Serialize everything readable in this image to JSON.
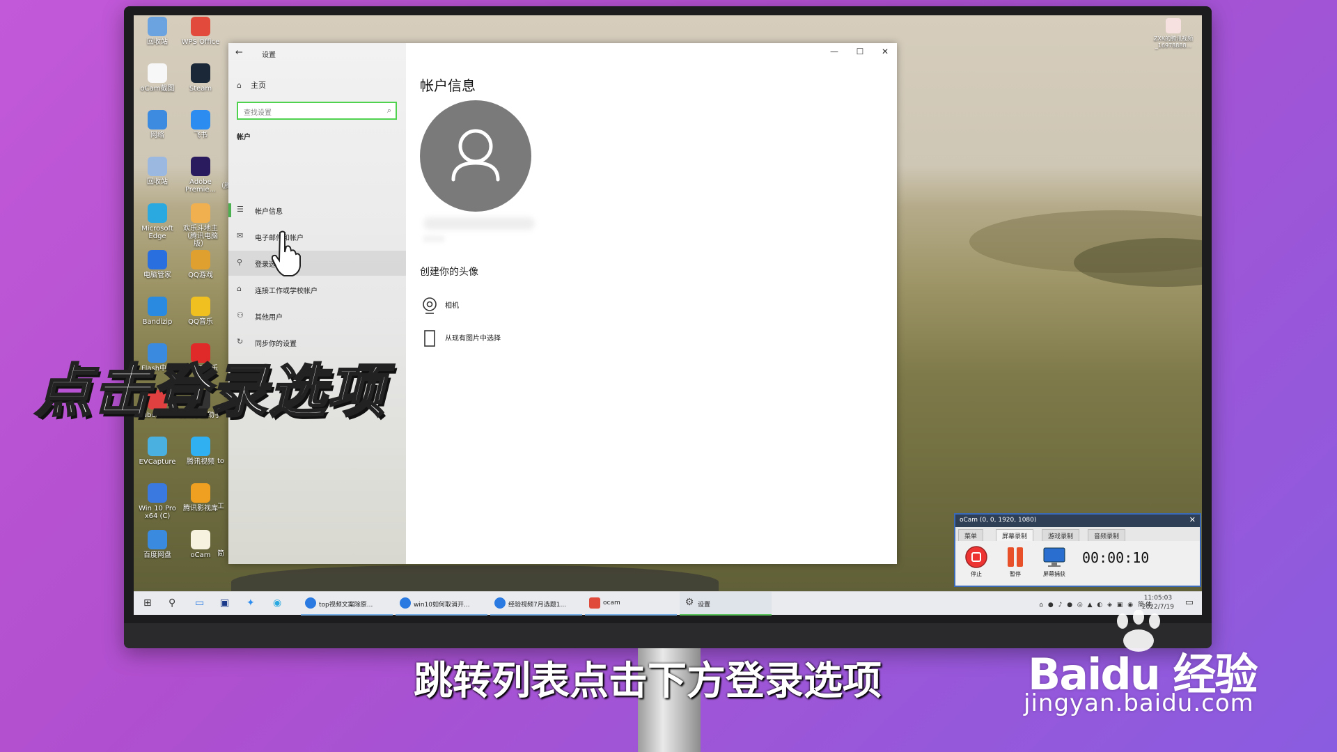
{
  "desktop_icons": [
    {
      "label": "回收站",
      "color": "#6ba3e0"
    },
    {
      "label": "WPS Office",
      "color": "#e24b3b"
    },
    {
      "label": "oCam截图",
      "color": "#f7f7f7"
    },
    {
      "label": "Steam",
      "color": "#1b2838"
    },
    {
      "label": "网络",
      "color": "#3c8be0"
    },
    {
      "label": "飞书",
      "color": "#2d8cf0"
    },
    {
      "label": "回收站",
      "color": "#9ab8e0"
    },
    {
      "label": "Adobe Premie...",
      "color": "#2a1a5e"
    },
    {
      "label": "Microsoft Edge",
      "color": "#2aa9e0"
    },
    {
      "label": "欢乐斗地主（腾讯电脑版）",
      "color": "#f0b050"
    },
    {
      "label": "电脑管家",
      "color": "#2a6fe0"
    },
    {
      "label": "QQ游戏",
      "color": "#e0a030"
    },
    {
      "label": "Bandizip",
      "color": "#2a8ae0"
    },
    {
      "label": "QQ音乐",
      "color": "#f0c020"
    },
    {
      "label": "Flash中心",
      "color": "#3a8ae0"
    },
    {
      "label": "网易云音乐",
      "color": "#e02a2a"
    },
    {
      "label": "TubeDown",
      "color": "#e04040"
    },
    {
      "label": "腾讯手游助手",
      "color": "#333333"
    },
    {
      "label": "EVCapture",
      "color": "#4ab0e0"
    },
    {
      "label": "腾讯视频",
      "color": "#30b0f0"
    },
    {
      "label": "Win 10 Pro x64 (C)",
      "color": "#3a7ae0"
    },
    {
      "label": "腾讯影视库",
      "color": "#f0a020"
    },
    {
      "label": "百度网盘",
      "color": "#3a8ae0"
    },
    {
      "label": "oCam",
      "color": "#f7f2e0"
    }
  ],
  "desktop_extra": [
    "（腾",
    "to",
    "工",
    "简"
  ],
  "user": {
    "name": "ZXK的腾讯视频",
    "id": "_16978888..."
  },
  "settings": {
    "title": "设置",
    "back_icon": "←",
    "window_controls": {
      "minimize": "—",
      "maximize": "☐",
      "close": "✕"
    },
    "home": "主页",
    "search_placeholder": "查找设置",
    "section": "帐户",
    "nav": [
      {
        "label": "帐户信息",
        "icon": "☰"
      },
      {
        "label": "电子邮件和帐户",
        "icon": "✉"
      },
      {
        "label": "登录选项",
        "icon": "⚲"
      },
      {
        "label": "连接工作或学校帐户",
        "icon": "⌂"
      },
      {
        "label": "其他用户",
        "icon": "⚇"
      },
      {
        "label": "同步你的设置",
        "icon": "↻"
      }
    ],
    "main_title": "帐户信息",
    "avatar_section": "创建你的头像",
    "options": [
      {
        "label": "相机"
      },
      {
        "label": "从现有图片中选择"
      }
    ]
  },
  "taskbar": {
    "apps": [
      {
        "label": "top视频文案除原...",
        "color": "#2a7ae2"
      },
      {
        "label": "win10如何取消开...",
        "color": "#2a7ae2"
      },
      {
        "label": "经验视频7月选题1...",
        "color": "#2a7ae2"
      },
      {
        "label": "ocam",
        "color": "#e04a3a"
      },
      {
        "label": "设置",
        "color": "#555555"
      }
    ],
    "ime": "简体",
    "time": "11:05:03",
    "date": "2022/7/19"
  },
  "ocam": {
    "title": "oCam (0, 0, 1920, 1080)",
    "tabs": [
      "菜单",
      "屏幕录制",
      "游戏录制",
      "音频录制"
    ],
    "buttons": [
      {
        "label": "停止"
      },
      {
        "label": "暂停"
      },
      {
        "label": "屏幕捕获"
      }
    ],
    "timer": "00:00:10"
  },
  "overlay": {
    "caption": "点击登录选项",
    "subtitle": "跳转列表点击下方登录选项"
  },
  "watermark": {
    "brand": "Baidu 经验",
    "url": "jingyan.baidu.com"
  },
  "colors": {
    "accent": "#4caf50",
    "search_border": "#4fd34f",
    "ocam_border": "#3b6bb8",
    "background": "#c259d8"
  }
}
